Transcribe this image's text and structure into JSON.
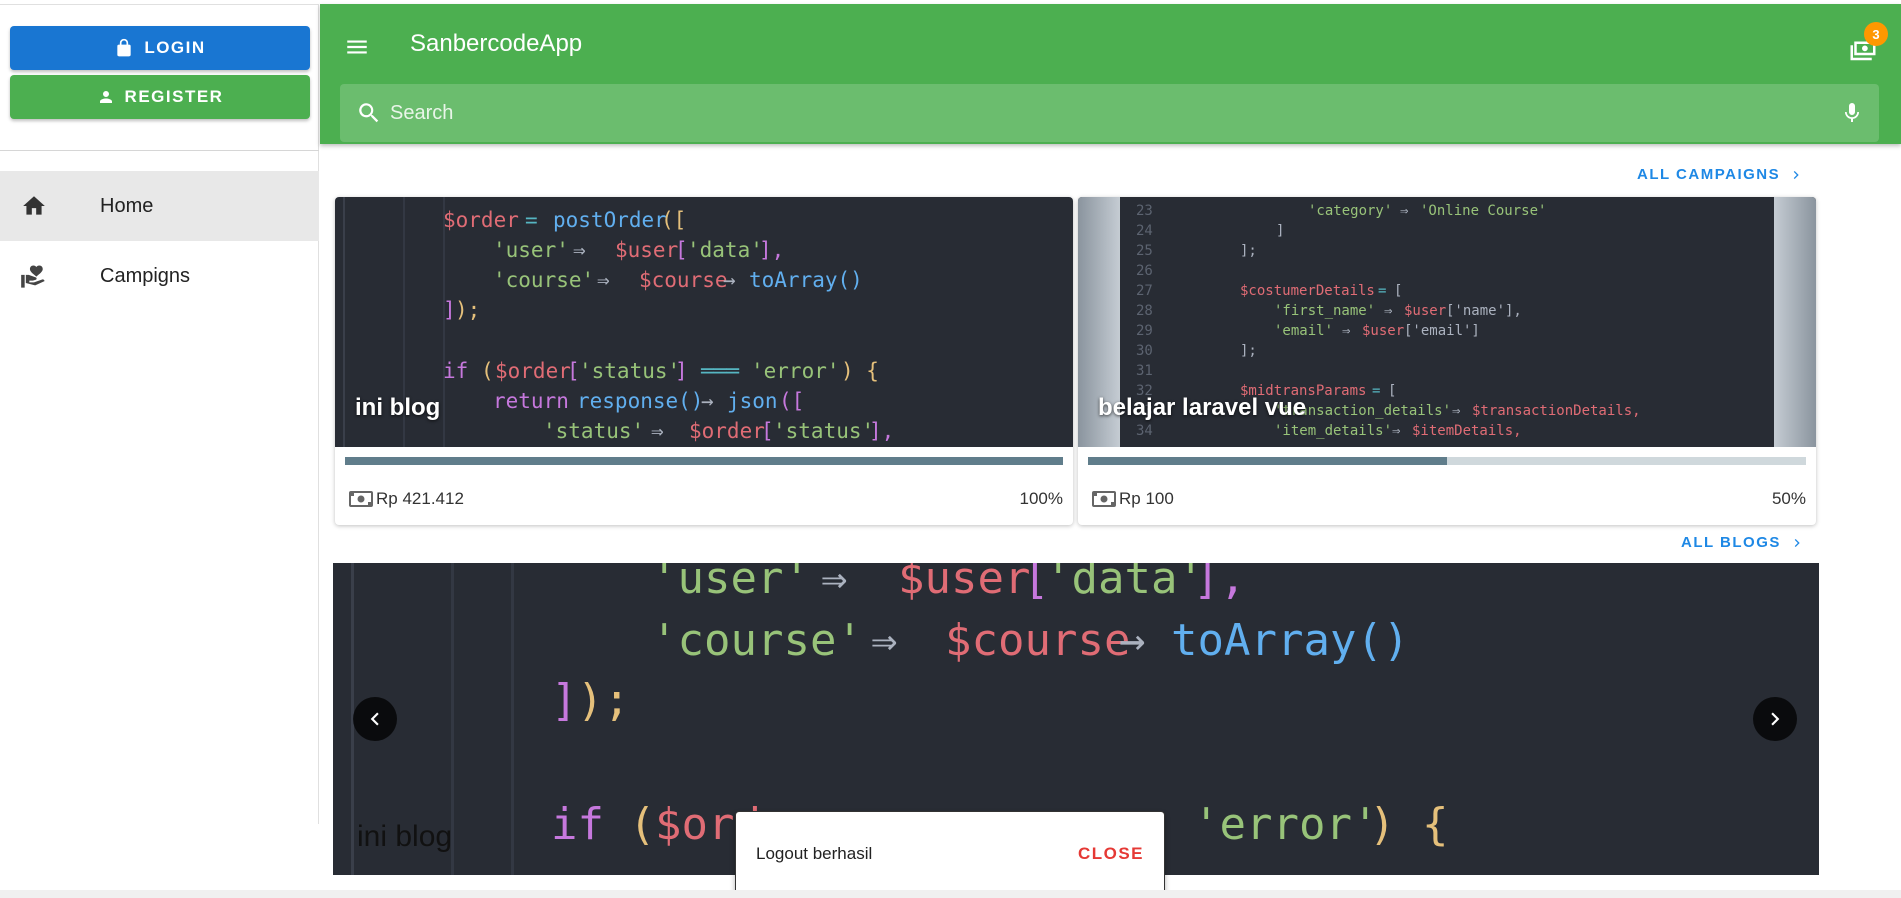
{
  "auth": {
    "login_label": "LOGIN",
    "register_label": "REGISTER"
  },
  "nav": {
    "items": [
      {
        "label": "Home",
        "icon": "home-icon",
        "active": true
      },
      {
        "label": "Campigns",
        "icon": "donation-icon",
        "active": false
      }
    ]
  },
  "header": {
    "title": "SanbercodeApp",
    "cart_badge": "3"
  },
  "search": {
    "placeholder": "Search"
  },
  "campaigns": {
    "link_label": "ALL CAMPAIGNS",
    "items": [
      {
        "title": "ini blog",
        "amount": "Rp 421.412",
        "percent": "100%",
        "progress": 1.0
      },
      {
        "title": "belajar laravel vue",
        "amount": "Rp 100",
        "percent": "50%",
        "progress": 0.5
      }
    ]
  },
  "blogs": {
    "link_label": "ALL BLOGS",
    "carousel_caption": "ini blog"
  },
  "snackbar": {
    "message": "Logout berhasil",
    "close_label": "CLOSE"
  },
  "colors": {
    "primary_green": "#4caf50",
    "login_blue": "#1976d2",
    "link_blue": "#1e88e5",
    "close_red": "#e53935",
    "badge_orange": "#ff9800"
  }
}
